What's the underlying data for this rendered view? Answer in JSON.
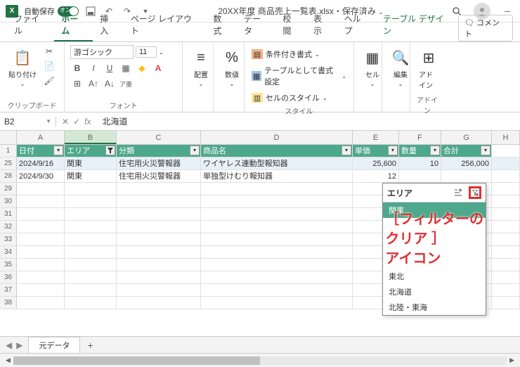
{
  "titlebar": {
    "autosave_label": "自動保存",
    "autosave_state": "オン",
    "filename": "20XX年度 商品売上一覧表.xlsx・保存済み"
  },
  "tabs": {
    "file": "ファイル",
    "home": "ホーム",
    "insert": "挿入",
    "pagelayout": "ページ レイアウト",
    "formulas": "数式",
    "data": "データ",
    "review": "校閲",
    "view": "表示",
    "help": "ヘルプ",
    "tabledesign": "テーブル デザイン",
    "comment": "コメント"
  },
  "ribbon": {
    "clipboard": {
      "paste": "貼り付け",
      "label": "クリップボード"
    },
    "font": {
      "name": "游ゴシック",
      "size": "11",
      "label": "フォント"
    },
    "align": {
      "btn": "配置",
      "label": ""
    },
    "number": {
      "btn": "数値",
      "pct": "%",
      "label": ""
    },
    "styles": {
      "cond": "条件付き書式",
      "table": "テーブルとして書式設定",
      "cell": "セルのスタイル",
      "label": "スタイル"
    },
    "cells": {
      "btn": "セル"
    },
    "editing": {
      "btn": "編集"
    },
    "addins": {
      "btn": "アドイン",
      "label": "アドイン"
    }
  },
  "formula": {
    "namebox": "B2",
    "value": "北海道"
  },
  "columns": [
    "A",
    "B",
    "C",
    "D",
    "E",
    "F",
    "G",
    "H"
  ],
  "headers": {
    "date": "日付",
    "area": "エリア",
    "cat": "分類",
    "product": "商品名",
    "price": "単価",
    "qty": "数量",
    "total": "合計"
  },
  "rows": [
    {
      "n": "25",
      "date": "2024/9/16",
      "area": "関東",
      "cat": "住宅用火災警報器",
      "product": "ワイヤレス連動型報知器",
      "price": "25,600",
      "qty": "10",
      "total": "256,000"
    },
    {
      "n": "28",
      "date": "2024/9/30",
      "area": "関東",
      "cat": "住宅用火災警報器",
      "product": "単独型けむり報知器",
      "price": "12",
      "qty": "",
      "total": ""
    }
  ],
  "empty_rows": [
    "29",
    "30",
    "31",
    "32",
    "33",
    "34",
    "35",
    "36",
    "37",
    "38"
  ],
  "filter": {
    "title": "エリア",
    "items": [
      "関東",
      "",
      "",
      "",
      "",
      "東北",
      "北海道",
      "北陸・東海"
    ]
  },
  "annotation": {
    "l1": "［フィルターの",
    "l2": "クリア ］",
    "l3": "アイコン"
  },
  "sheet": {
    "name": "元データ"
  }
}
